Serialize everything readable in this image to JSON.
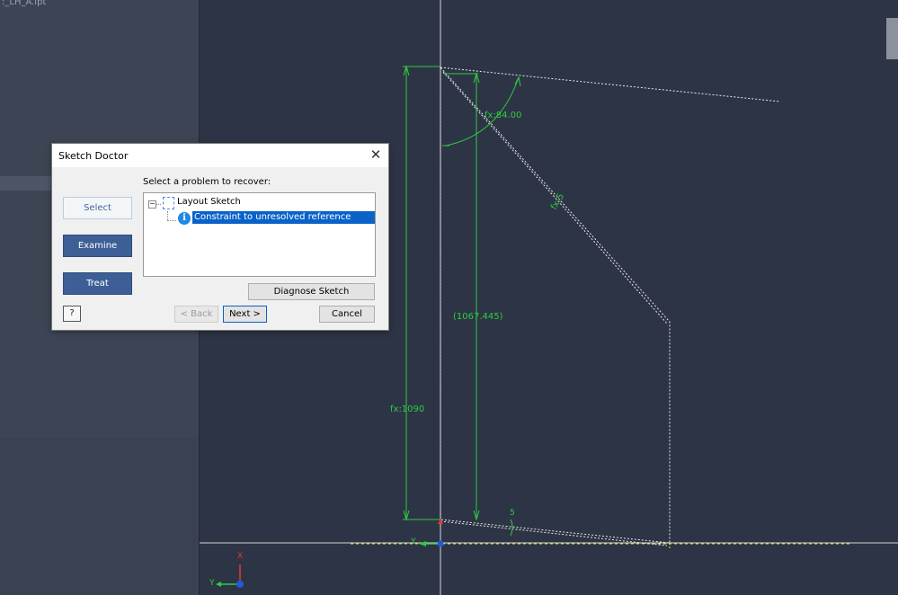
{
  "browser": {
    "filename": ":_LH_A.ipt"
  },
  "sketch": {
    "dimensions": {
      "angle": "fx:84.00",
      "slant": "fx:5",
      "reference": "(1067.445)",
      "height": "fx:1090",
      "bottom_angle": "5"
    },
    "axis_labels": {
      "y": "Y",
      "x": "X"
    }
  },
  "dialog": {
    "title": "Sketch Doctor",
    "close_glyph": "✕",
    "steps": [
      "Select",
      "Examine",
      "Treat"
    ],
    "prompt": "Select a problem to recover:",
    "tree": {
      "expander": "−",
      "root": "Layout Sketch",
      "info_glyph": "i",
      "problem": "Constraint to unresolved reference geometry"
    },
    "buttons": {
      "diagnose": "Diagnose Sketch",
      "back": "< Back",
      "next": "Next >",
      "cancel": "Cancel",
      "help": "?"
    }
  },
  "colors": {
    "canvas": "#2d3445",
    "dimension": "#2ecc40",
    "construction": "#e8e8e8",
    "axis_x": "#e0e040",
    "selection": "#0a62c9",
    "step_button": "#3e5f96"
  }
}
